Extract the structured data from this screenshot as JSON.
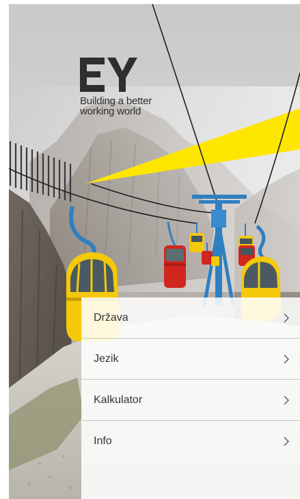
{
  "brand": {
    "logo_text": "EY",
    "tagline_line1": "Building a better",
    "tagline_line2": "working world",
    "accent_color": "#ffe600"
  },
  "menu": {
    "items": [
      {
        "label": "Država",
        "icon": "chevron-right-icon"
      },
      {
        "label": "Jezik",
        "icon": "chevron-right-icon"
      },
      {
        "label": "Kalkulator",
        "icon": "chevron-right-icon"
      },
      {
        "label": "Info",
        "icon": "chevron-right-icon"
      }
    ]
  }
}
